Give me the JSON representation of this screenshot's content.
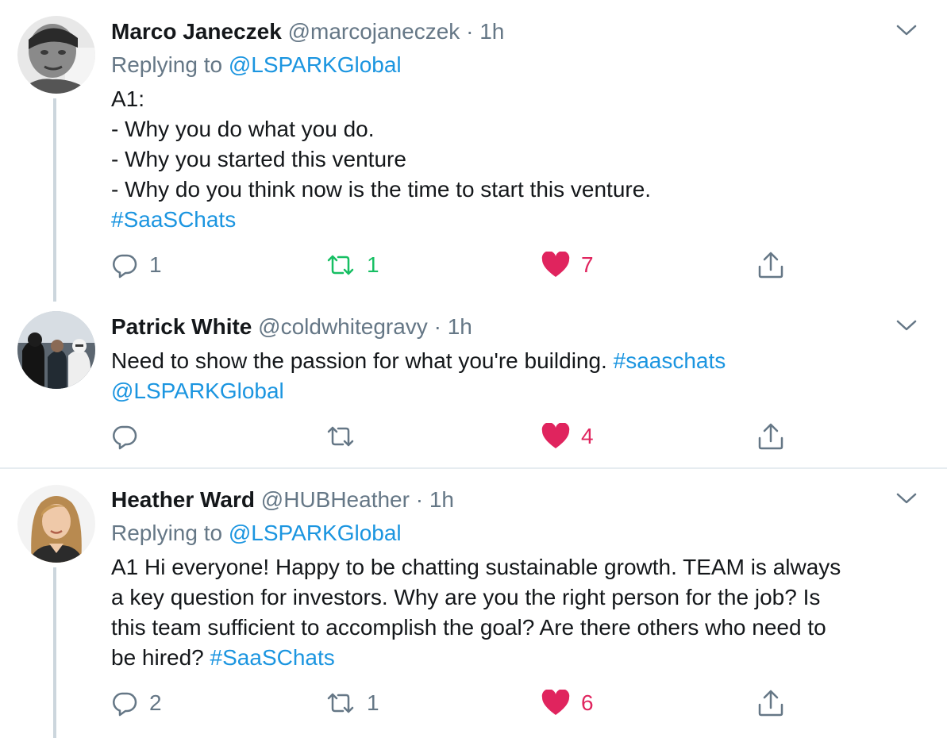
{
  "tweets": [
    {
      "name": "Marco Janeczek",
      "handle": "@marcojaneczek",
      "dot": "·",
      "time": "1h",
      "replying_prefix": "Replying to",
      "replying_to": "@LSPARKGlobal",
      "lines": [
        "A1:",
        "- Why you do what you do.",
        "- Why you started this venture",
        "- Why do you think now is the time to start this venture."
      ],
      "hashtag": "#SaaSChats",
      "reply_count": "1",
      "retweet_count": "1",
      "like_count": "7"
    },
    {
      "name": "Patrick White",
      "handle": "@coldwhitegravy",
      "dot": "·",
      "time": "1h",
      "line1_text": "Need to show the passion for what you're building.",
      "line1_hashtag": "#saaschats",
      "line2_mention": "@LSPARKGlobal",
      "reply_count": "",
      "retweet_count": "",
      "like_count": "4"
    },
    {
      "name": "Heather Ward",
      "handle": "@HUBHeather",
      "dot": "·",
      "time": "1h",
      "replying_prefix": "Replying to",
      "replying_to": "@LSPARKGlobal",
      "lines": [
        "A1 Hi everyone! Happy to be chatting sustainable growth. TEAM is always",
        "a key question for investors. Why are you the right person for the job? Is",
        "this team sufficient to accomplish the goal? Are there others who need to"
      ],
      "last_line_text": "be hired?",
      "hashtag": "#SaaSChats",
      "reply_count": "2",
      "retweet_count": "1",
      "like_count": "6"
    }
  ],
  "colors": {
    "text": "#14171a",
    "secondary": "#657786",
    "link": "#1b95e0",
    "retweet": "#17bf63",
    "like": "#e0245e",
    "thread_line": "#ccd6dd",
    "divider": "#e6ecf0"
  },
  "icons": [
    "reply-icon",
    "retweet-icon",
    "heart-icon",
    "share-icon",
    "chevron-down-icon"
  ]
}
